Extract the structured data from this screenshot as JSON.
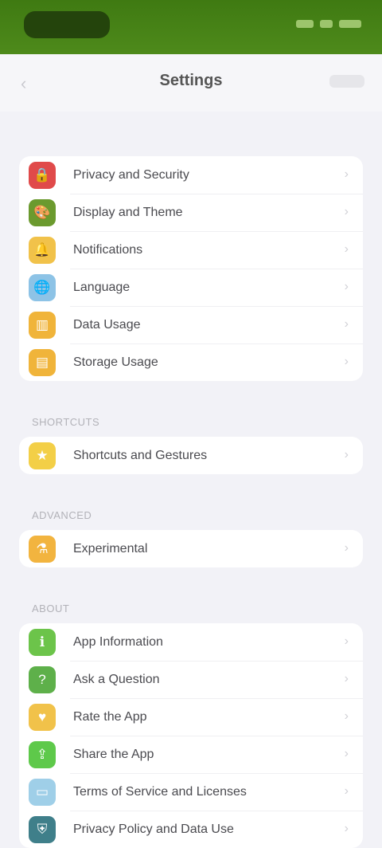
{
  "header": {
    "title": "Settings"
  },
  "icons": {
    "accent": "#4e8a1b"
  },
  "groups": [
    {
      "label": "",
      "items": [
        {
          "label": "Privacy and Security",
          "icon": "lock-icon",
          "color": "#e04a4a"
        },
        {
          "label": "Display and Theme",
          "icon": "paint-icon",
          "color": "#6b9a2e"
        },
        {
          "label": "Notifications",
          "icon": "bell-icon",
          "color": "#f1c24a"
        },
        {
          "label": "Language",
          "icon": "globe-icon",
          "color": "#8dc3e6"
        },
        {
          "label": "Data Usage",
          "icon": "chart-icon",
          "color": "#f0b43a"
        },
        {
          "label": "Storage Usage",
          "icon": "folder-icon",
          "color": "#f0b43a"
        }
      ]
    },
    {
      "label": "Shortcuts",
      "items": [
        {
          "label": "Shortcuts and Gestures",
          "icon": "star-icon",
          "color": "#f3cf47"
        }
      ]
    },
    {
      "label": "Advanced",
      "items": [
        {
          "label": "Experimental",
          "icon": "flask-icon",
          "color": "#f2b43f"
        }
      ]
    },
    {
      "label": "About",
      "items": [
        {
          "label": "App Information",
          "icon": "info-icon",
          "color": "#6cc44a"
        },
        {
          "label": "Ask a Question",
          "icon": "question-icon",
          "color": "#5eb04a"
        },
        {
          "label": "Rate the App",
          "icon": "heart-icon",
          "color": "#f1c24a"
        },
        {
          "label": "Share the App",
          "icon": "share-icon",
          "color": "#5ec94a"
        },
        {
          "label": "Terms of Service and Licenses",
          "icon": "document-icon",
          "color": "#9fcfe8"
        },
        {
          "label": "Privacy Policy and Data Use",
          "icon": "shield-icon",
          "color": "#3f7f8a"
        }
      ]
    }
  ]
}
